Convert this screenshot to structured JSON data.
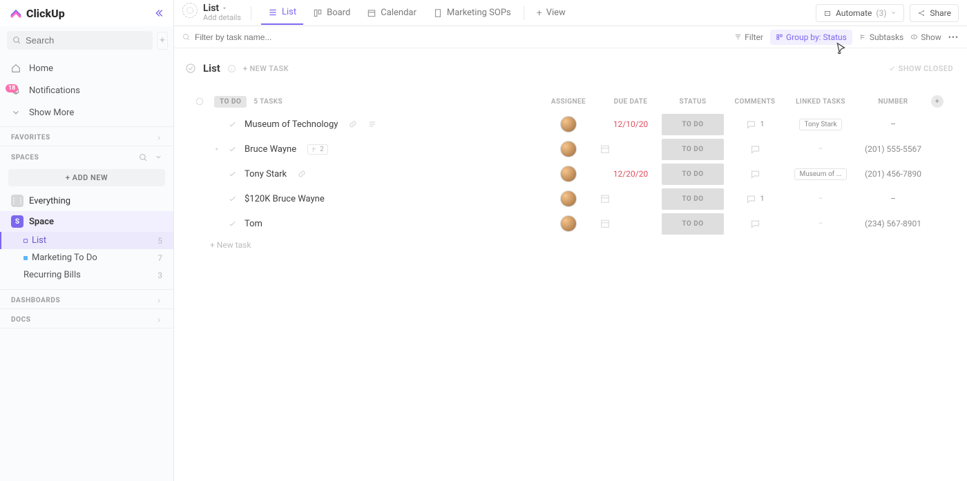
{
  "brand": {
    "name": "ClickUp"
  },
  "sidebar": {
    "search_placeholder": "Search",
    "nav": {
      "home": "Home",
      "notifications": "Notifications",
      "notif_badge": "18",
      "show_more": "Show More"
    },
    "favorites_label": "FAVORITES",
    "spaces_label": "SPACES",
    "add_new": "+  ADD NEW",
    "everything": "Everything",
    "space_name": "Space",
    "lists": [
      {
        "name": "List",
        "count": "5"
      },
      {
        "name": "Marketing To Do",
        "count": "7"
      },
      {
        "name": "Recurring Bills",
        "count": "3"
      }
    ],
    "dashboards_label": "DASHBOARDS",
    "docs_label": "DOCS"
  },
  "header": {
    "list_title": "List",
    "list_sub": "Add details",
    "tabs": {
      "list": "List",
      "board": "Board",
      "calendar": "Calendar",
      "doc": "Marketing SOPs",
      "view": "View"
    },
    "automate_label": "Automate",
    "automate_count": "(3)",
    "share": "Share"
  },
  "filterbar": {
    "placeholder": "Filter by task name...",
    "filter": "Filter",
    "groupby": "Group by: Status",
    "subtasks": "Subtasks",
    "show": "Show"
  },
  "group": {
    "title": "List",
    "new_task": "+ NEW TASK",
    "show_closed": "SHOW CLOSED",
    "status_chip": "TO DO",
    "task_count": "5 TASKS",
    "cols": {
      "assignee": "ASSIGNEE",
      "due": "DUE DATE",
      "status": "STATUS",
      "comments": "COMMENTS",
      "linked": "LINKED TASKS",
      "number": "NUMBER"
    },
    "new_task_row": "+ New task"
  },
  "tasks": [
    {
      "name": "Museum of Technology",
      "has_link": true,
      "has_desc": true,
      "sub": "",
      "due": "12/10/20",
      "due_red": true,
      "status": "TO DO",
      "comments": "1",
      "linked": "Tony Stark",
      "number": "–",
      "expand": false
    },
    {
      "name": "Bruce Wayne",
      "has_link": false,
      "has_desc": false,
      "sub": "2",
      "due": "",
      "due_red": false,
      "status": "TO DO",
      "comments": "",
      "linked": "–",
      "number": "(201) 555-5567",
      "expand": true
    },
    {
      "name": "Tony Stark",
      "has_link": true,
      "has_desc": false,
      "sub": "",
      "due": "12/20/20",
      "due_red": true,
      "status": "TO DO",
      "comments": "",
      "linked": "Museum of ...",
      "number": "(201) 456-7890",
      "expand": false
    },
    {
      "name": "$120K Bruce Wayne",
      "has_link": false,
      "has_desc": false,
      "sub": "",
      "due": "",
      "due_red": false,
      "status": "TO DO",
      "comments": "1",
      "linked": "–",
      "number": "–",
      "expand": false
    },
    {
      "name": "Tom",
      "has_link": false,
      "has_desc": false,
      "sub": "",
      "due": "",
      "due_red": false,
      "status": "TO DO",
      "comments": "",
      "linked": "–",
      "number": "(234) 567-8901",
      "expand": false
    }
  ]
}
